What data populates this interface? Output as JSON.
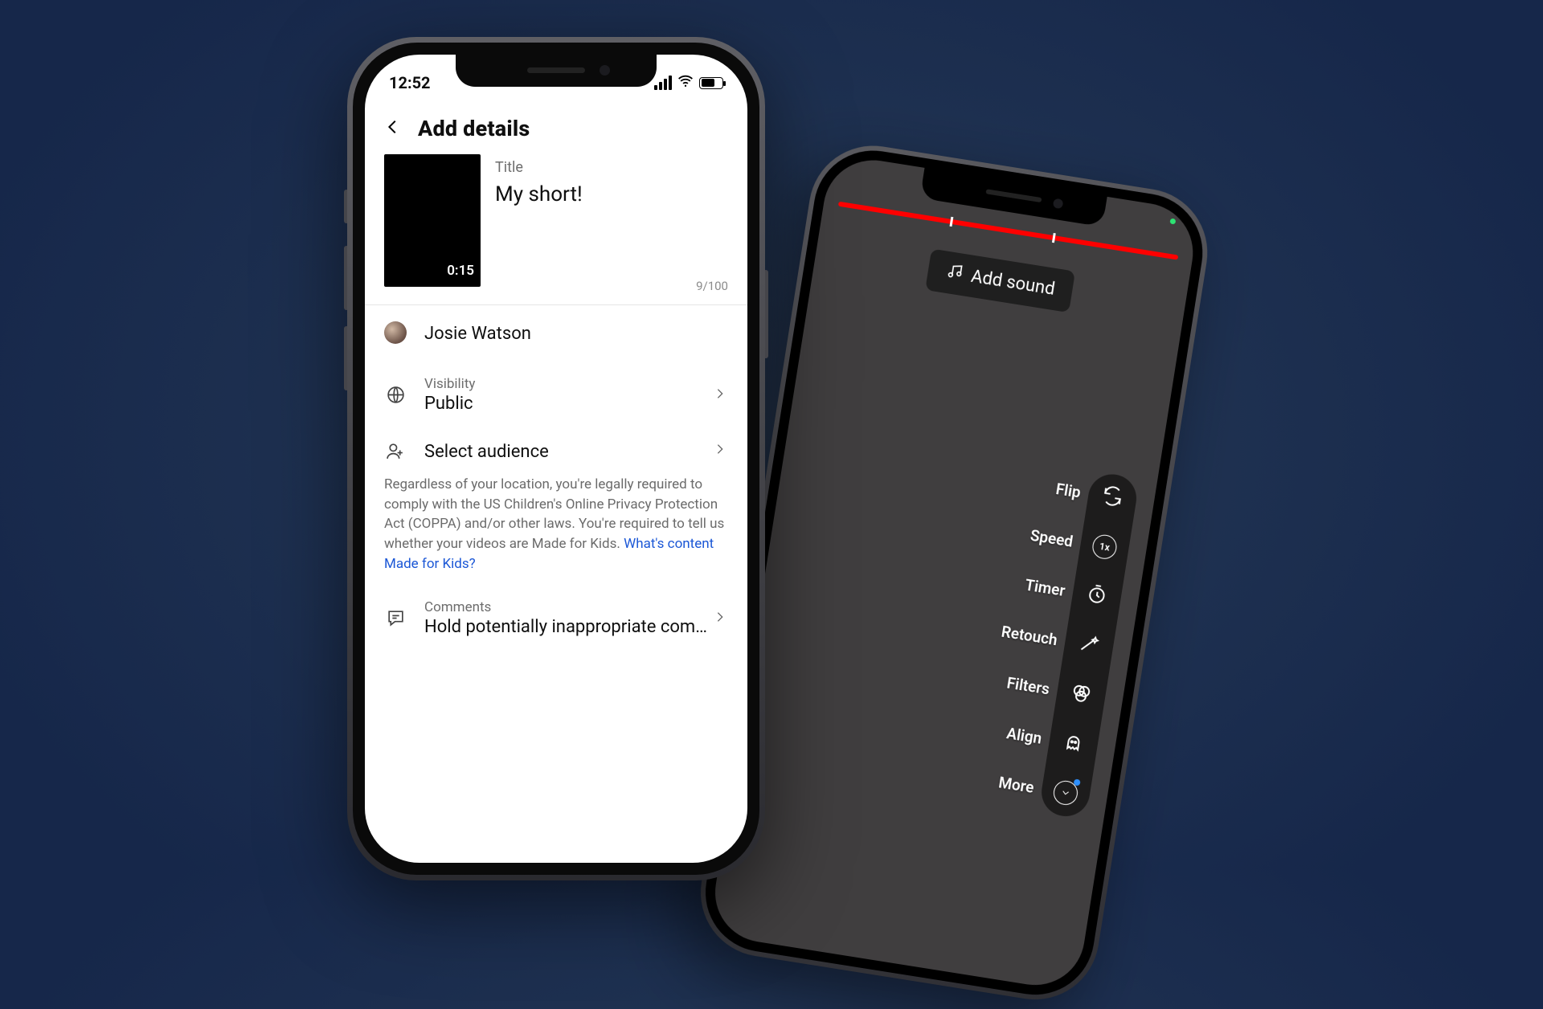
{
  "phone1": {
    "status": {
      "time": "12:52"
    },
    "nav_title": "Add details",
    "thumbnail": {
      "duration": "0:15"
    },
    "title_section": {
      "label": "Title",
      "value": "My short!",
      "counter": "9/100"
    },
    "user": {
      "name": "Josie Watson"
    },
    "visibility": {
      "label": "Visibility",
      "value": "Public"
    },
    "audience": {
      "label": "Select audience"
    },
    "legal_text": "Regardless of your location, you're legally required to comply with the US Children's Online Privacy Protection Act (COPPA) and/or other laws. You're required to tell us whether your videos are Made for Kids. ",
    "legal_link": "What's content Made for Kids?",
    "comments": {
      "label": "Comments",
      "value": "Hold potentially inappropriate com…"
    }
  },
  "phone2": {
    "add_sound": "Add sound",
    "tools": {
      "flip": "Flip",
      "speed": {
        "label": "Speed",
        "badge": "1x"
      },
      "timer": "Timer",
      "retouch": "Retouch",
      "filters": "Filters",
      "align": "Align",
      "more": "More"
    }
  }
}
